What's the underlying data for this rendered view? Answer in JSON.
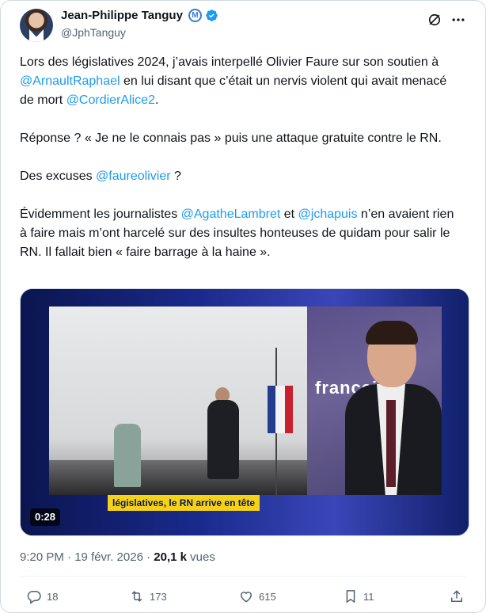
{
  "author": {
    "display_name": "Jean-Philippe Tanguy",
    "handle": "@JphTanguy",
    "affiliation_badge": "M"
  },
  "tweet": {
    "p1": {
      "t1": "Lors des législatives 2024, j’avais interpellé Olivier Faure sur son soutien à ",
      "m1": "@ArnaultRaphael",
      "t2": " en lui disant que c’était un nervis violent qui avait menacé de mort ",
      "m2": "@CordierAlice2",
      "t3": "."
    },
    "p2": {
      "t1": "Réponse ? « Je ne le connais pas » puis une attaque gratuite contre le RN."
    },
    "p3": {
      "t1": "Des excuses ",
      "m1": "@faureolivier",
      "t2": " ?"
    },
    "p4": {
      "t1": "Évidemment les journalistes ",
      "m1": "@AgatheLambret",
      "t2": " et ",
      "m2": "@jchapuis",
      "t3": " n’en avaient rien à faire mais m’ont harcelé sur des insultes honteuses de quidam pour salir le RN. Il fallait bien « faire barrage à la haine »."
    }
  },
  "video": {
    "banner": "législatives, le RN arrive en tête",
    "logo_text": "franceinfo:",
    "duration": "0:28"
  },
  "meta": {
    "time": "9:20 PM · 19 févr. 2026 · ",
    "views_count": "20,1 k",
    "views_label": " vues"
  },
  "actions": {
    "replies": "18",
    "retweets": "173",
    "likes": "615",
    "bookmarks": "11"
  },
  "colors": {
    "link": "#1d9bf0",
    "muted": "#536471",
    "verified": "#1d9bf0"
  }
}
